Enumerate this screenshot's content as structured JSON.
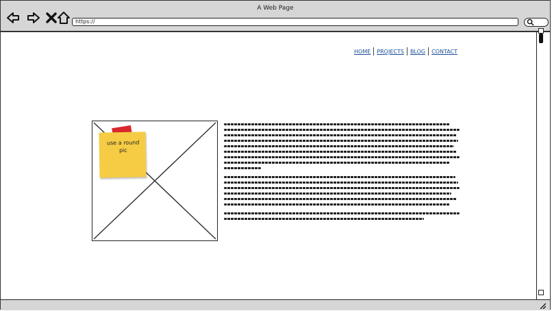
{
  "window": {
    "title": "A Web Page"
  },
  "toolbar": {
    "back_icon": "back-arrow-icon",
    "forward_icon": "forward-arrow-icon",
    "stop_icon": "close-icon",
    "home_icon": "home-icon",
    "url": "https://",
    "search_icon": "search-icon"
  },
  "nav": {
    "items": [
      {
        "label": "HOME"
      },
      {
        "label": "PROJECTS"
      },
      {
        "label": "BLOG"
      },
      {
        "label": "CONTACT"
      }
    ]
  },
  "image_placeholder": {
    "sticky_note": "use a round pic"
  },
  "colors": {
    "chrome": "#d6d6d6",
    "link": "#1a4d99",
    "sticky": "#f6cc45",
    "tape": "#d9282d"
  }
}
